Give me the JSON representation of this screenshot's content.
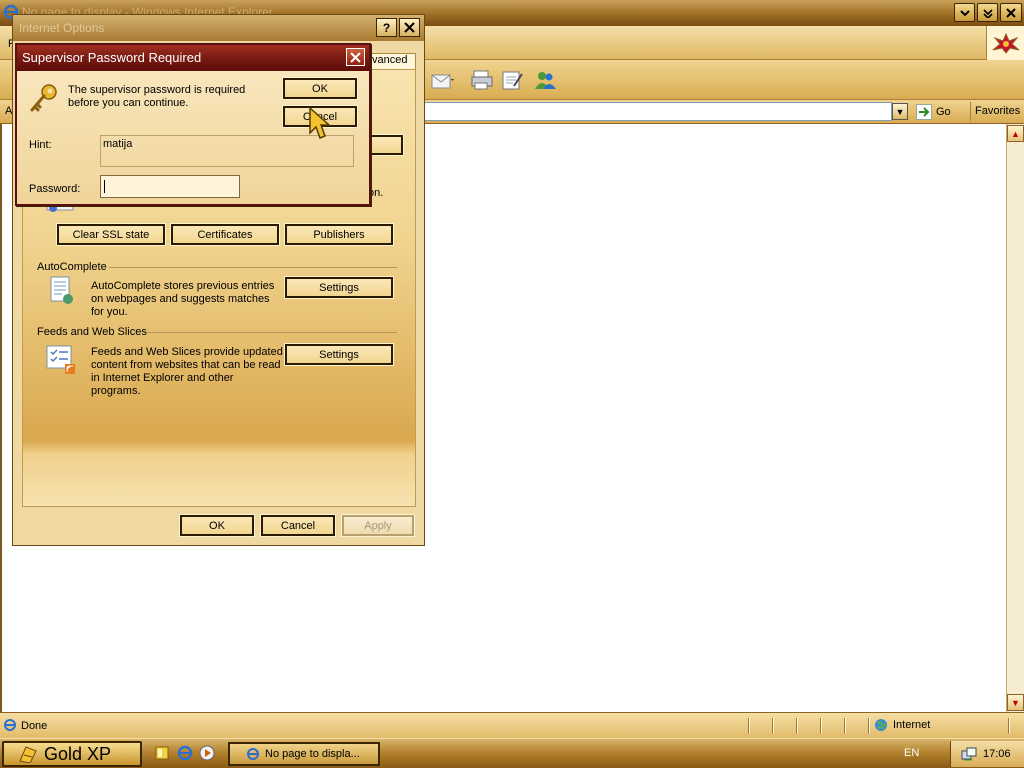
{
  "browser": {
    "title": "No page to display - Windows Internet Explorer",
    "menu_letter": "F",
    "address_label": "A",
    "go_label": "Go",
    "favorites_label": "Favorites",
    "status_text": "Done",
    "zone_label": "Internet"
  },
  "internet_options": {
    "title": "Internet Options",
    "tab_partial": "vanced",
    "section_partial_text": "on.",
    "content_buttons": [
      "Clear SSL state",
      "Certificates",
      "Publishers"
    ],
    "autocomplete": {
      "heading": "AutoComplete",
      "description": "AutoComplete stores previous entries on webpages and suggests matches for you.",
      "button": "Settings"
    },
    "feeds": {
      "heading": "Feeds and Web Slices",
      "description": "Feeds and Web Slices provide updated content from websites that can be read in Internet Explorer and other programs.",
      "button": "Settings"
    },
    "footer": {
      "ok": "OK",
      "cancel": "Cancel",
      "apply": "Apply"
    }
  },
  "supervisor_dialog": {
    "title": "Supervisor Password Required",
    "message": "The supervisor password is required before you can continue.",
    "ok": "OK",
    "cancel": "Cancel",
    "hint_label": "Hint:",
    "hint_value": "matija",
    "password_label": "Password:",
    "password_value": ""
  },
  "taskbar": {
    "start_label": "Gold XP",
    "task_label": "No page to displa...",
    "language": "EN",
    "clock": "17:06"
  },
  "colors": {
    "gold_accent": "#d9ac52",
    "dialog_title_red": "#7a1a12"
  }
}
